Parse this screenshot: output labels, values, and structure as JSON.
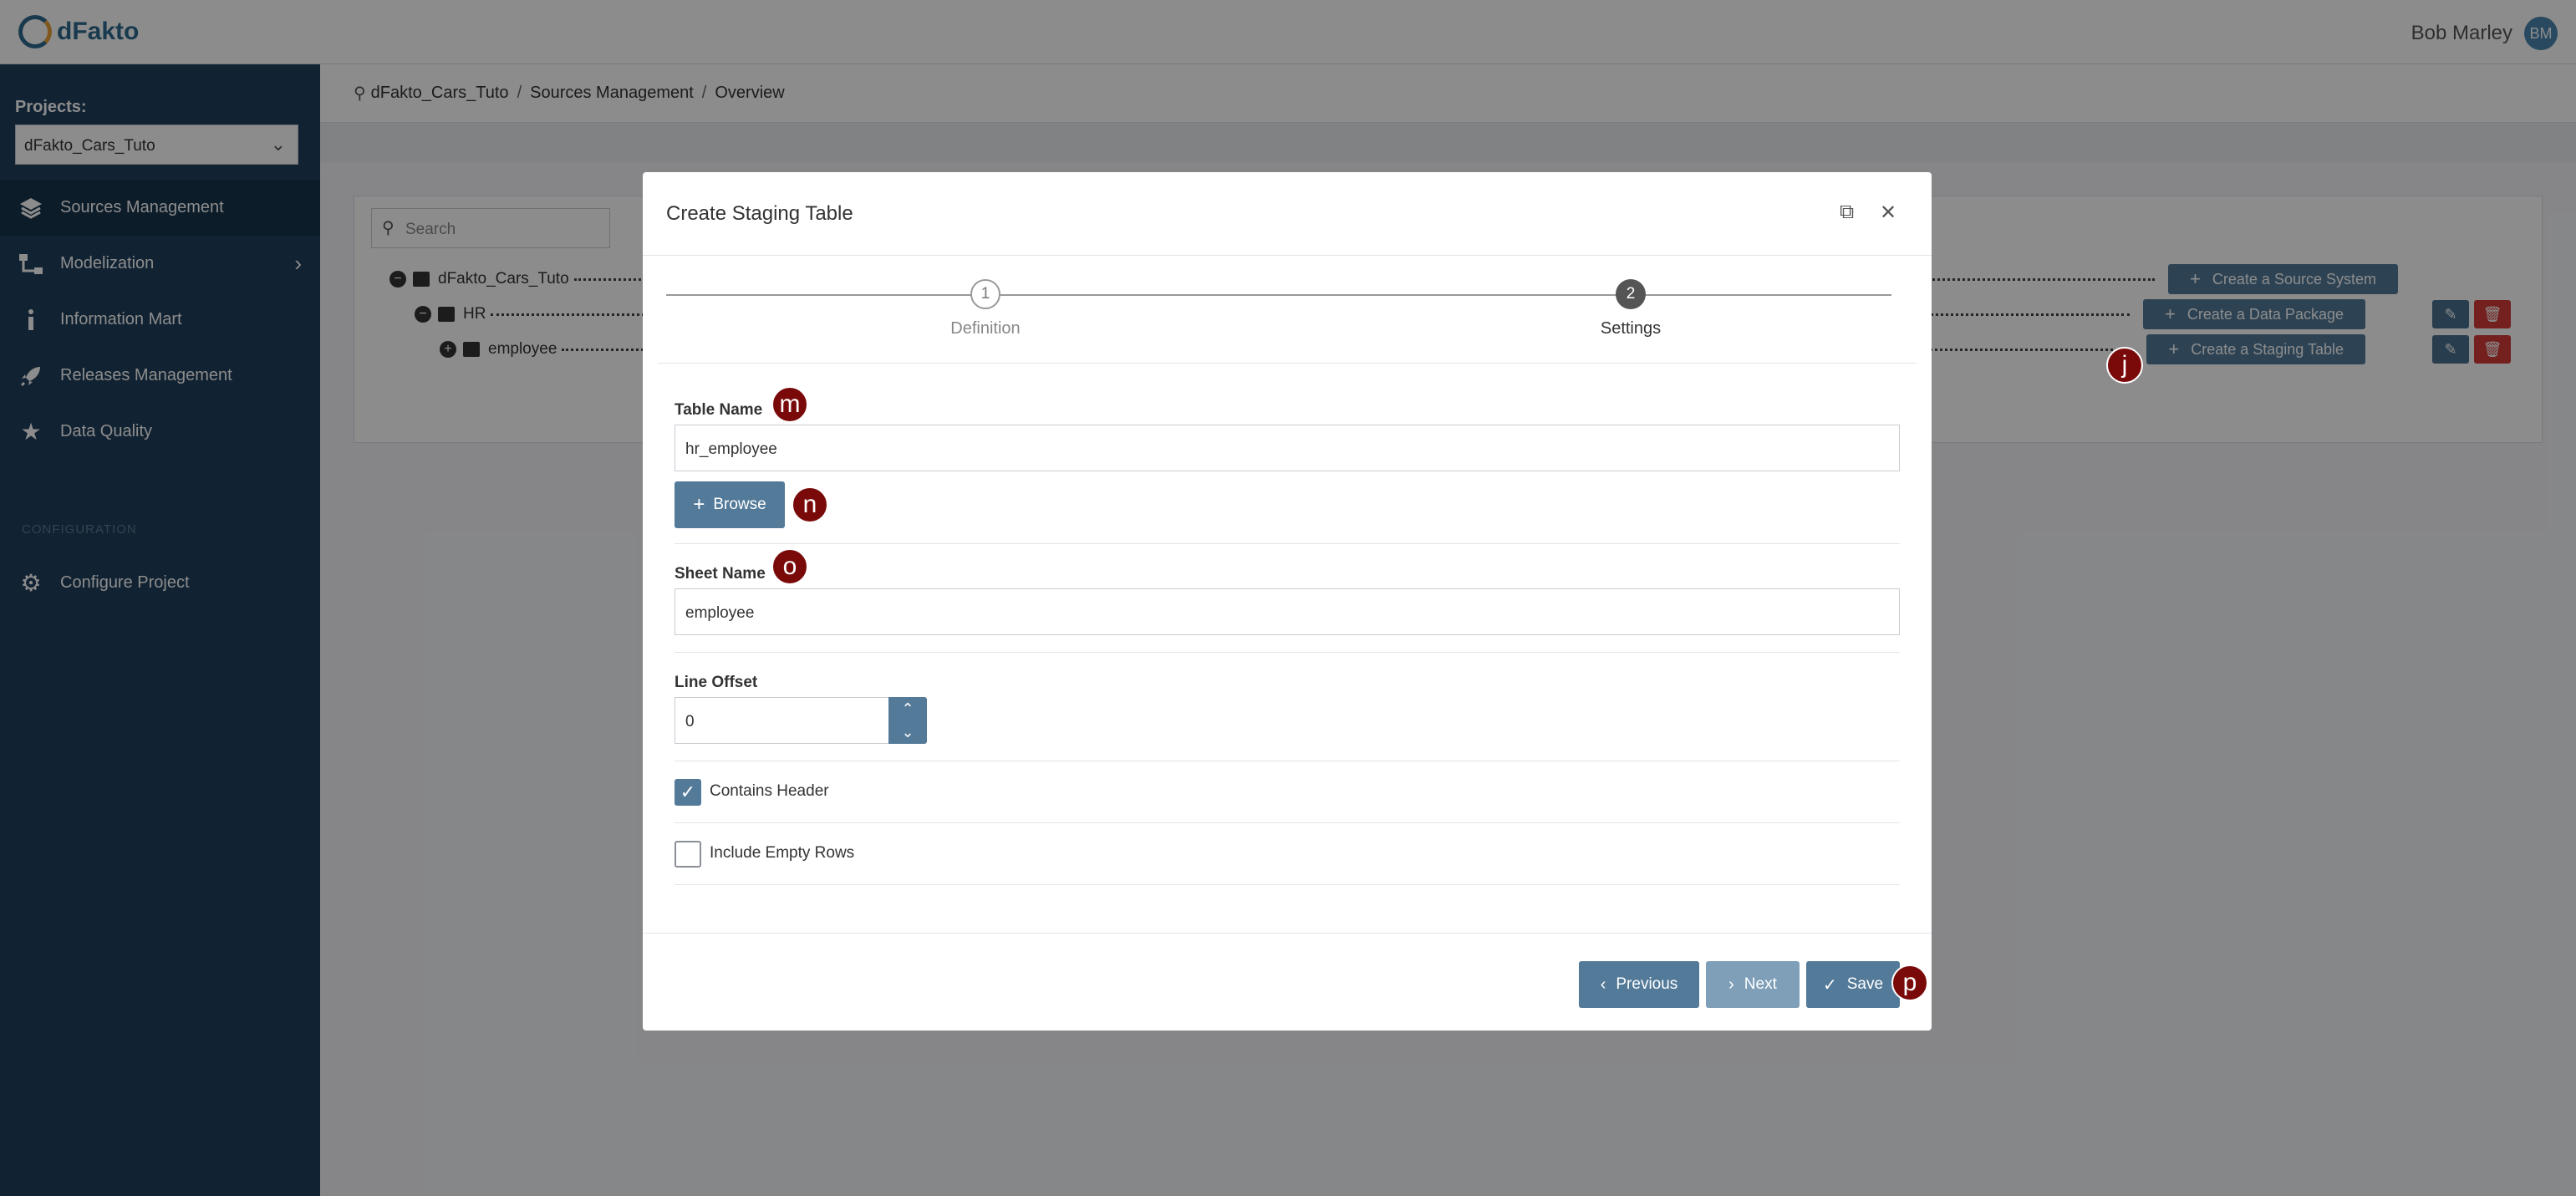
{
  "header": {
    "logo_text": "dFakto",
    "user_name": "Bob Marley",
    "user_initials": "BM"
  },
  "sidebar": {
    "projects_label": "Projects:",
    "project_selected": "dFakto_Cars_Tuto",
    "items": [
      {
        "label": "Sources Management",
        "icon": "layers-icon",
        "active": true
      },
      {
        "label": "Modelization",
        "icon": "sitemap-icon"
      },
      {
        "label": "Information Mart",
        "icon": "info-icon"
      },
      {
        "label": "Releases Management",
        "icon": "rocket-icon"
      },
      {
        "label": "Data Quality",
        "icon": "star-icon"
      }
    ],
    "section_configuration": "CONFIGURATION",
    "config_item": {
      "label": "Configure Project",
      "icon": "gear-icon"
    }
  },
  "breadcrumb": [
    "dFakto_Cars_Tuto",
    "Sources Management",
    "Overview"
  ],
  "search": {
    "placeholder": "Search"
  },
  "tree": [
    {
      "label": "dFakto_Cars_Tuto",
      "toggle": "−",
      "action": "Create a Source System",
      "has_edit": false
    },
    {
      "label": "HR",
      "toggle": "−",
      "action": "Create a Data Package",
      "has_edit": true
    },
    {
      "label": "employee",
      "toggle": "+",
      "action": "Create a Staging Table",
      "has_edit": true
    }
  ],
  "modal": {
    "title": "Create Staging Table",
    "steps": [
      {
        "number": "1",
        "label": "Definition"
      },
      {
        "number": "2",
        "label": "Settings"
      }
    ],
    "table_name_label": "Table Name",
    "table_name_value": "hr_employee",
    "browse_label": "Browse",
    "sheet_name_label": "Sheet Name",
    "sheet_name_value": "employee",
    "line_offset_label": "Line Offset",
    "line_offset_value": "0",
    "contains_header_label": "Contains Header",
    "contains_header_checked": true,
    "include_empty_rows_label": "Include Empty Rows",
    "include_empty_rows_checked": false,
    "btn_previous": "Previous",
    "btn_next": "Next",
    "btn_save": "Save"
  },
  "markers": {
    "j": "j",
    "m": "m",
    "n": "n",
    "o": "o",
    "p": "p"
  },
  "colors": {
    "sidebar_bg": "#1f3f5b",
    "primary_button": "#537a99",
    "danger_button": "#d13b37",
    "marker": "#7a0a0a"
  }
}
